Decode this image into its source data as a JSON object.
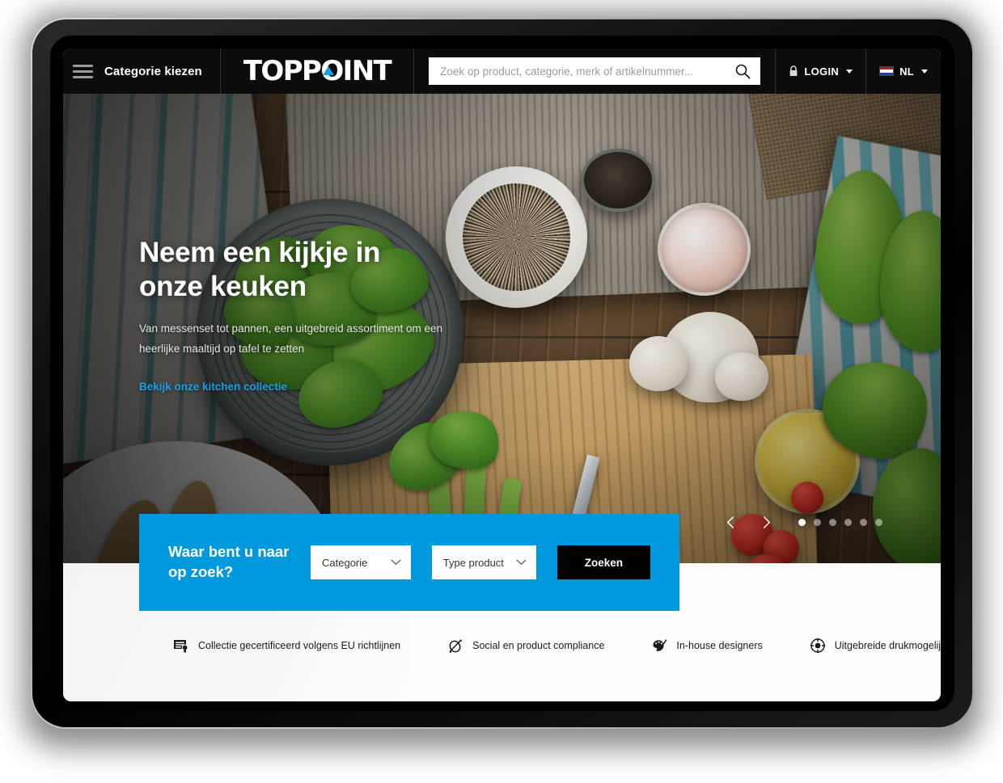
{
  "header": {
    "menu_label": "Categorie kiezen",
    "logo_text": "TOPPOINT",
    "search_placeholder": "Zoek op product, categorie, merk of artikelnummer...",
    "search_value": "",
    "login_label": "LOGIN",
    "language_label": "NL"
  },
  "hero": {
    "title": "Neem een kijkje in onze keuken",
    "subtitle": "Van messenset tot pannen, een uitgebreid assortiment om een heerlijke maaltijd op tafel te zetten",
    "cta_label": "Bekijk onze kitchen collectie",
    "carousel": {
      "slide_count": 6,
      "active_slide": 1
    }
  },
  "search_panel": {
    "title": "Waar bent u naar op zoek?",
    "category_select": "Categorie",
    "product_type_select": "Type product",
    "submit_label": "Zoeken"
  },
  "features": [
    {
      "icon": "certificate-icon",
      "label": "Collectie gecertificeerd volgens EU richtlijnen"
    },
    {
      "icon": "compliance-icon",
      "label": "Social en product compliance"
    },
    {
      "icon": "palette-icon",
      "label": "In-house designers"
    },
    {
      "icon": "print-target-icon",
      "label": "Uitgebreide drukmogelijkheden"
    }
  ],
  "colors": {
    "accent_blue": "#0099dd",
    "logo_blue": "#18a0e0",
    "nav_black": "#0c0c0c",
    "button_black": "#000000"
  }
}
